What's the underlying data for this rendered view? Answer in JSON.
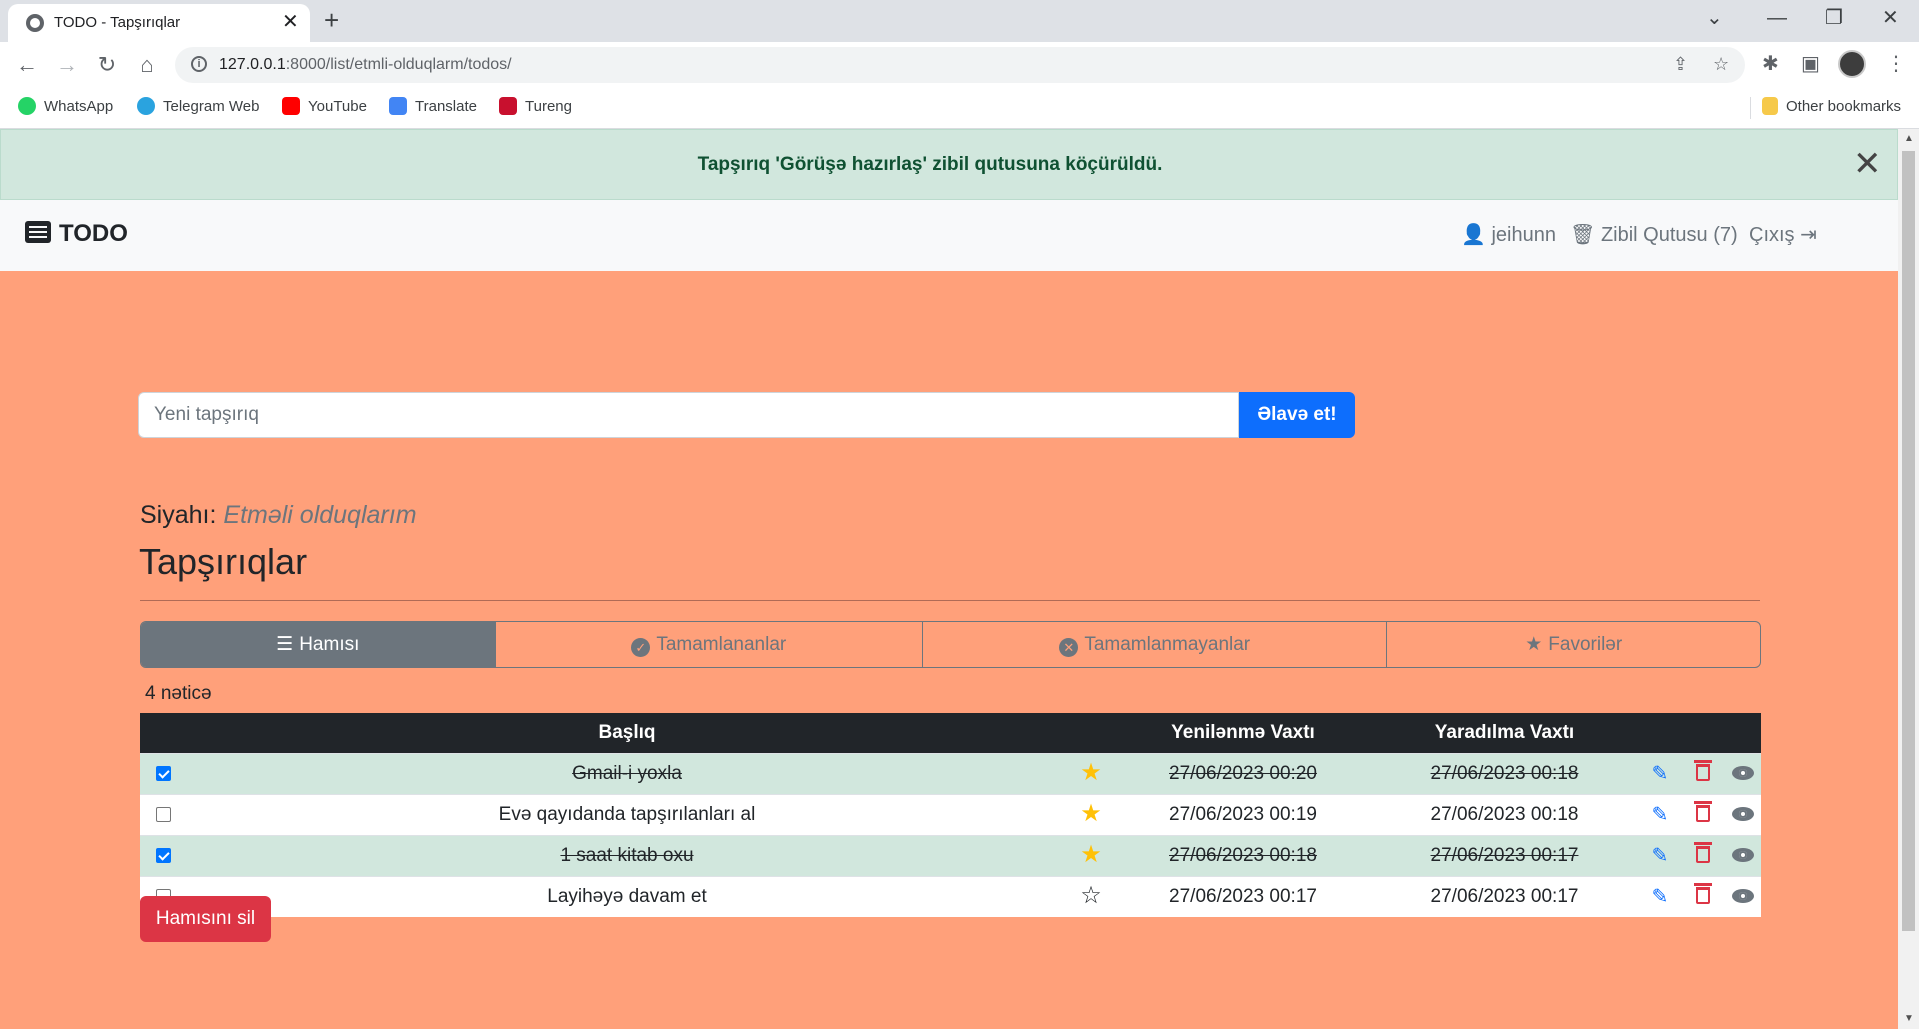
{
  "browser": {
    "tab_title": "TODO - Tapşırıqlar",
    "url_host": "127.0.0.1",
    "url_rest": ":8000/list/etmli-olduqlarm/todos/",
    "bookmarks": [
      "WhatsApp",
      "Telegram Web",
      "YouTube",
      "Translate",
      "Tureng"
    ],
    "other_bookmarks": "Other bookmarks"
  },
  "alert": {
    "message": "Tapşırıq 'Görüşə hazırlaş' zibil qutusuna köçürüldü."
  },
  "navbar": {
    "brand": "TODO",
    "user": "jeihunn",
    "trash": "Zibil Qutusu (7)",
    "logout": "Çıxış"
  },
  "form": {
    "placeholder": "Yeni tapşırıq",
    "submit_label": "Əlavə et!"
  },
  "list": {
    "label": "Siyahı:",
    "name": "Etməli olduqlarım"
  },
  "heading": "Tapşırıqlar",
  "filters": [
    "Hamısı",
    "Tamamlananlar",
    "Tamamlanmayanlar",
    "Favorilər"
  ],
  "active_filter": "Hamısı",
  "result_count": "4 nəticə",
  "table": {
    "headers": [
      "",
      "Başlıq",
      "",
      "Yenilənmə Vaxtı",
      "Yaradılma Vaxtı",
      "",
      "",
      ""
    ],
    "rows": [
      {
        "title": "Gmail-i yoxla",
        "completed": true,
        "favorite": true,
        "updated": "27/06/2023 00:20",
        "created": "27/06/2023 00:18"
      },
      {
        "title": "Evə qayıdanda tapşırılanları al",
        "completed": false,
        "favorite": true,
        "updated": "27/06/2023 00:19",
        "created": "27/06/2023 00:18"
      },
      {
        "title": "1 saat kitab oxu",
        "completed": true,
        "favorite": true,
        "updated": "27/06/2023 00:18",
        "created": "27/06/2023 00:17"
      },
      {
        "title": "Layihəyə davam et",
        "completed": false,
        "favorite": false,
        "updated": "27/06/2023 00:17",
        "created": "27/06/2023 00:17"
      }
    ]
  },
  "delete_all_label": "Hamısını sil",
  "colors": {
    "page_bg": "#ffa07a",
    "alert_bg": "#d1e7dd",
    "primary": "#0d6efd",
    "danger": "#dc3545",
    "favorite": "#ffc107",
    "header_dark": "#212529"
  }
}
